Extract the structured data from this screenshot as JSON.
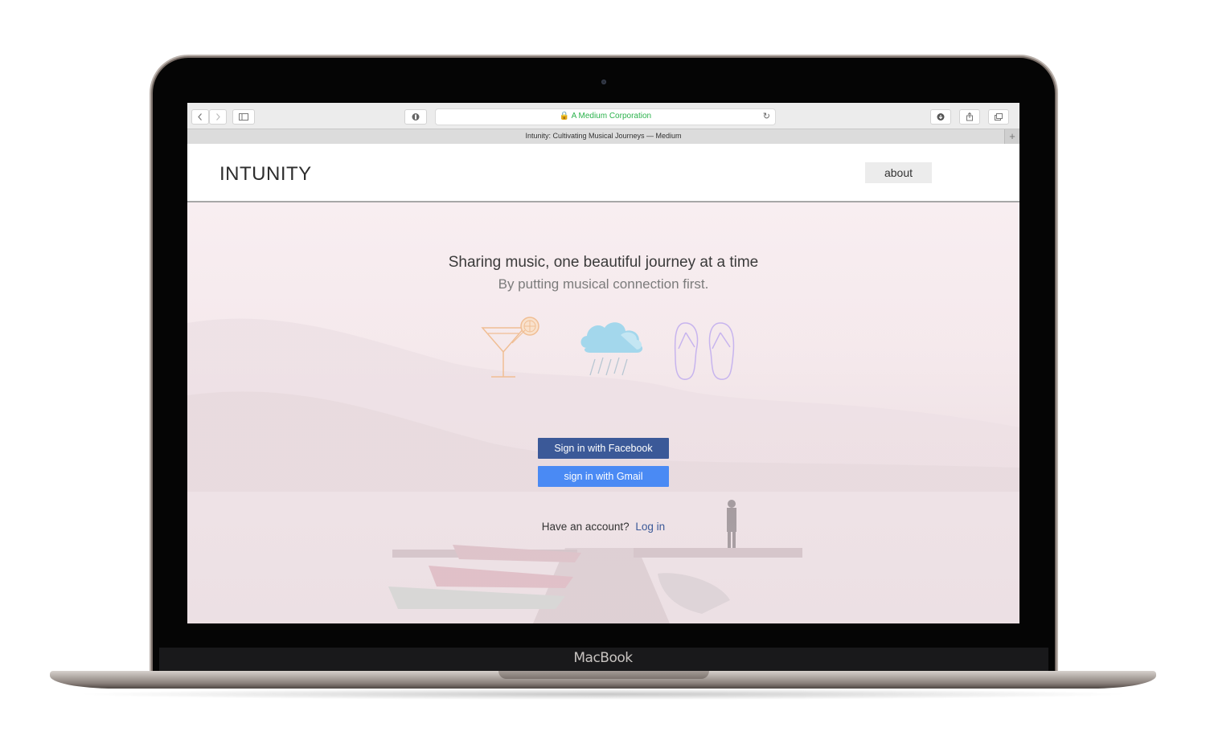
{
  "device": {
    "brand_label": "MacBook"
  },
  "browser": {
    "address_text": "A Medium Corporation",
    "tab_title": "Intunity: Cultivating Musical Journeys — Medium",
    "new_tab_label": "+"
  },
  "site": {
    "logo": "INTUNITY",
    "nav_about": "about"
  },
  "hero": {
    "headline": "Sharing music, one beautiful journey at a time",
    "subline": "By putting musical connection first.",
    "icons": [
      "cocktail-icon",
      "rain-cloud-icon",
      "flip-flops-icon"
    ],
    "facebook_button": "Sign in with Facebook",
    "gmail_button": "sign in with Gmail",
    "account_prompt": "Have an account?",
    "login_link": "Log in"
  },
  "colors": {
    "facebook": "#3b5998",
    "gmail": "#4a8af4",
    "secure_address": "#2bb24c",
    "cocktail": "#f2c49b",
    "cloud": "#9fd4ea",
    "flipflops": "#c9b7ee"
  }
}
